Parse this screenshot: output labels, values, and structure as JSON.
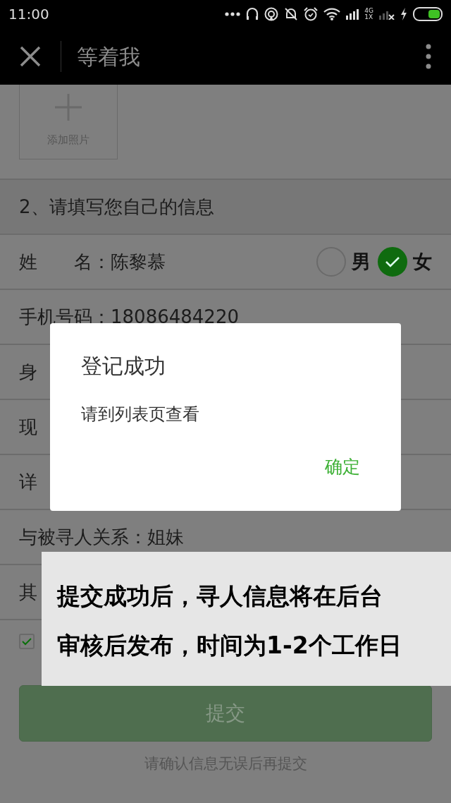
{
  "status_bar": {
    "time": "11:00",
    "network_top": "4G",
    "network_bottom": "1X"
  },
  "header": {
    "title": "等着我"
  },
  "photo": {
    "label": "添加照片"
  },
  "section_title": "2、请填写您自己的信息",
  "name_row": {
    "text": "姓　　名：陈黎慕",
    "gender": [
      {
        "label": "男",
        "selected": false
      },
      {
        "label": "女",
        "selected": true
      }
    ]
  },
  "rows": [
    "手机号码：18086484220",
    "身",
    "现",
    "详",
    "与被寻人关系：姐妹",
    "其"
  ],
  "agreement": {
    "checked": true
  },
  "submit": {
    "label": "提交"
  },
  "hint": "请确认信息无误后再提交",
  "dialog": {
    "title": "登记成功",
    "message": "请到列表页查看",
    "button": "确定"
  },
  "caption": {
    "lines": [
      "提交成功后，寻人信息将在后台",
      "审核后发布，时间为1-2个工作日"
    ]
  }
}
